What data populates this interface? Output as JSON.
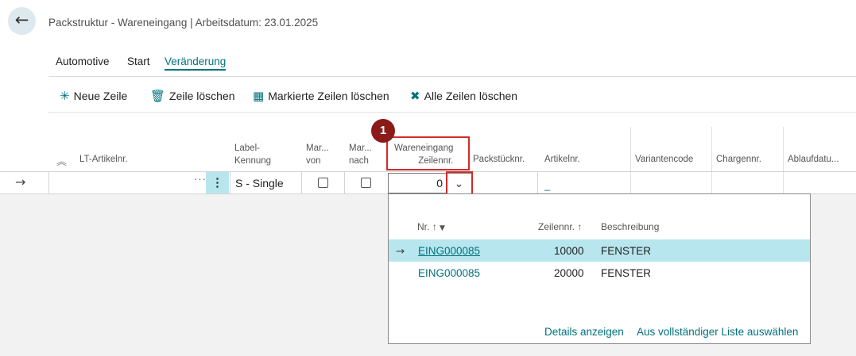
{
  "header": {
    "back_icon": "←",
    "title": "Packstruktur - Wareneingang | Arbeitsdatum: 23.01.2025"
  },
  "tabs": [
    {
      "label": "Automotive"
    },
    {
      "label": "Start"
    },
    {
      "label": "Veränderung",
      "active": true
    }
  ],
  "actions": [
    {
      "label": "Neue Zeile",
      "icon": "sparkle-icon",
      "glyph": "✳"
    },
    {
      "label": "Zeile löschen",
      "icon": "trash-icon",
      "glyph": "🗑"
    },
    {
      "label": "Markierte Zeilen löschen",
      "icon": "delete-marked-rows-icon",
      "glyph": "▦"
    },
    {
      "label": "Alle Zeilen löschen",
      "icon": "delete-all-rows-icon",
      "glyph": "✖"
    }
  ],
  "grid": {
    "sort_icon": "︽",
    "columns": {
      "lt_artikelnr": "LT-Artikelnr.",
      "label_kennung": "Label-\nKennung",
      "mar_von": "Mar...\nvon",
      "mar_nach": "Mar...\nnach",
      "wareneingang_zeilennr": "Wareneingang\nZeilennr.",
      "packstuecknr": "Packstücknr.",
      "artikelnr": "Artikelnr.",
      "variantencode": "Variantencode",
      "chargennr": "Chargennr.",
      "ablaufdatum": "Ablaufdatu..."
    },
    "row": {
      "arrow": "→",
      "ellipsis": "···",
      "menu": "⋮",
      "label_kennung": "S - Single",
      "mar_von_checked": false,
      "mar_nach_checked": false,
      "zeilennr": "0",
      "dropdown_icon": "⌄",
      "artikelnr": "_"
    }
  },
  "annotation": {
    "badge": "1",
    "color": "#d12a2a"
  },
  "lookup": {
    "headers": {
      "nr": "Nr.",
      "nr_sort": "↑",
      "filter_icon": "▼",
      "zeilennr": "Zeilennr.",
      "zeilennr_sort": "↑",
      "beschreibung": "Beschreibung"
    },
    "rows": [
      {
        "selected": true,
        "arrow": "→",
        "nr": "EING000085",
        "zeilennr": "10000",
        "beschreibung": "FENSTER"
      },
      {
        "selected": false,
        "arrow": "",
        "nr": "EING000085",
        "zeilennr": "20000",
        "beschreibung": "FENSTER"
      }
    ],
    "footer": {
      "details": "Details anzeigen",
      "full_list": "Aus vollständiger Liste auswählen"
    }
  },
  "colors": {
    "accent": "#00727d",
    "selection": "#b8e6ee",
    "annotation": "#d12a2a",
    "badge": "#8b1a1a"
  }
}
